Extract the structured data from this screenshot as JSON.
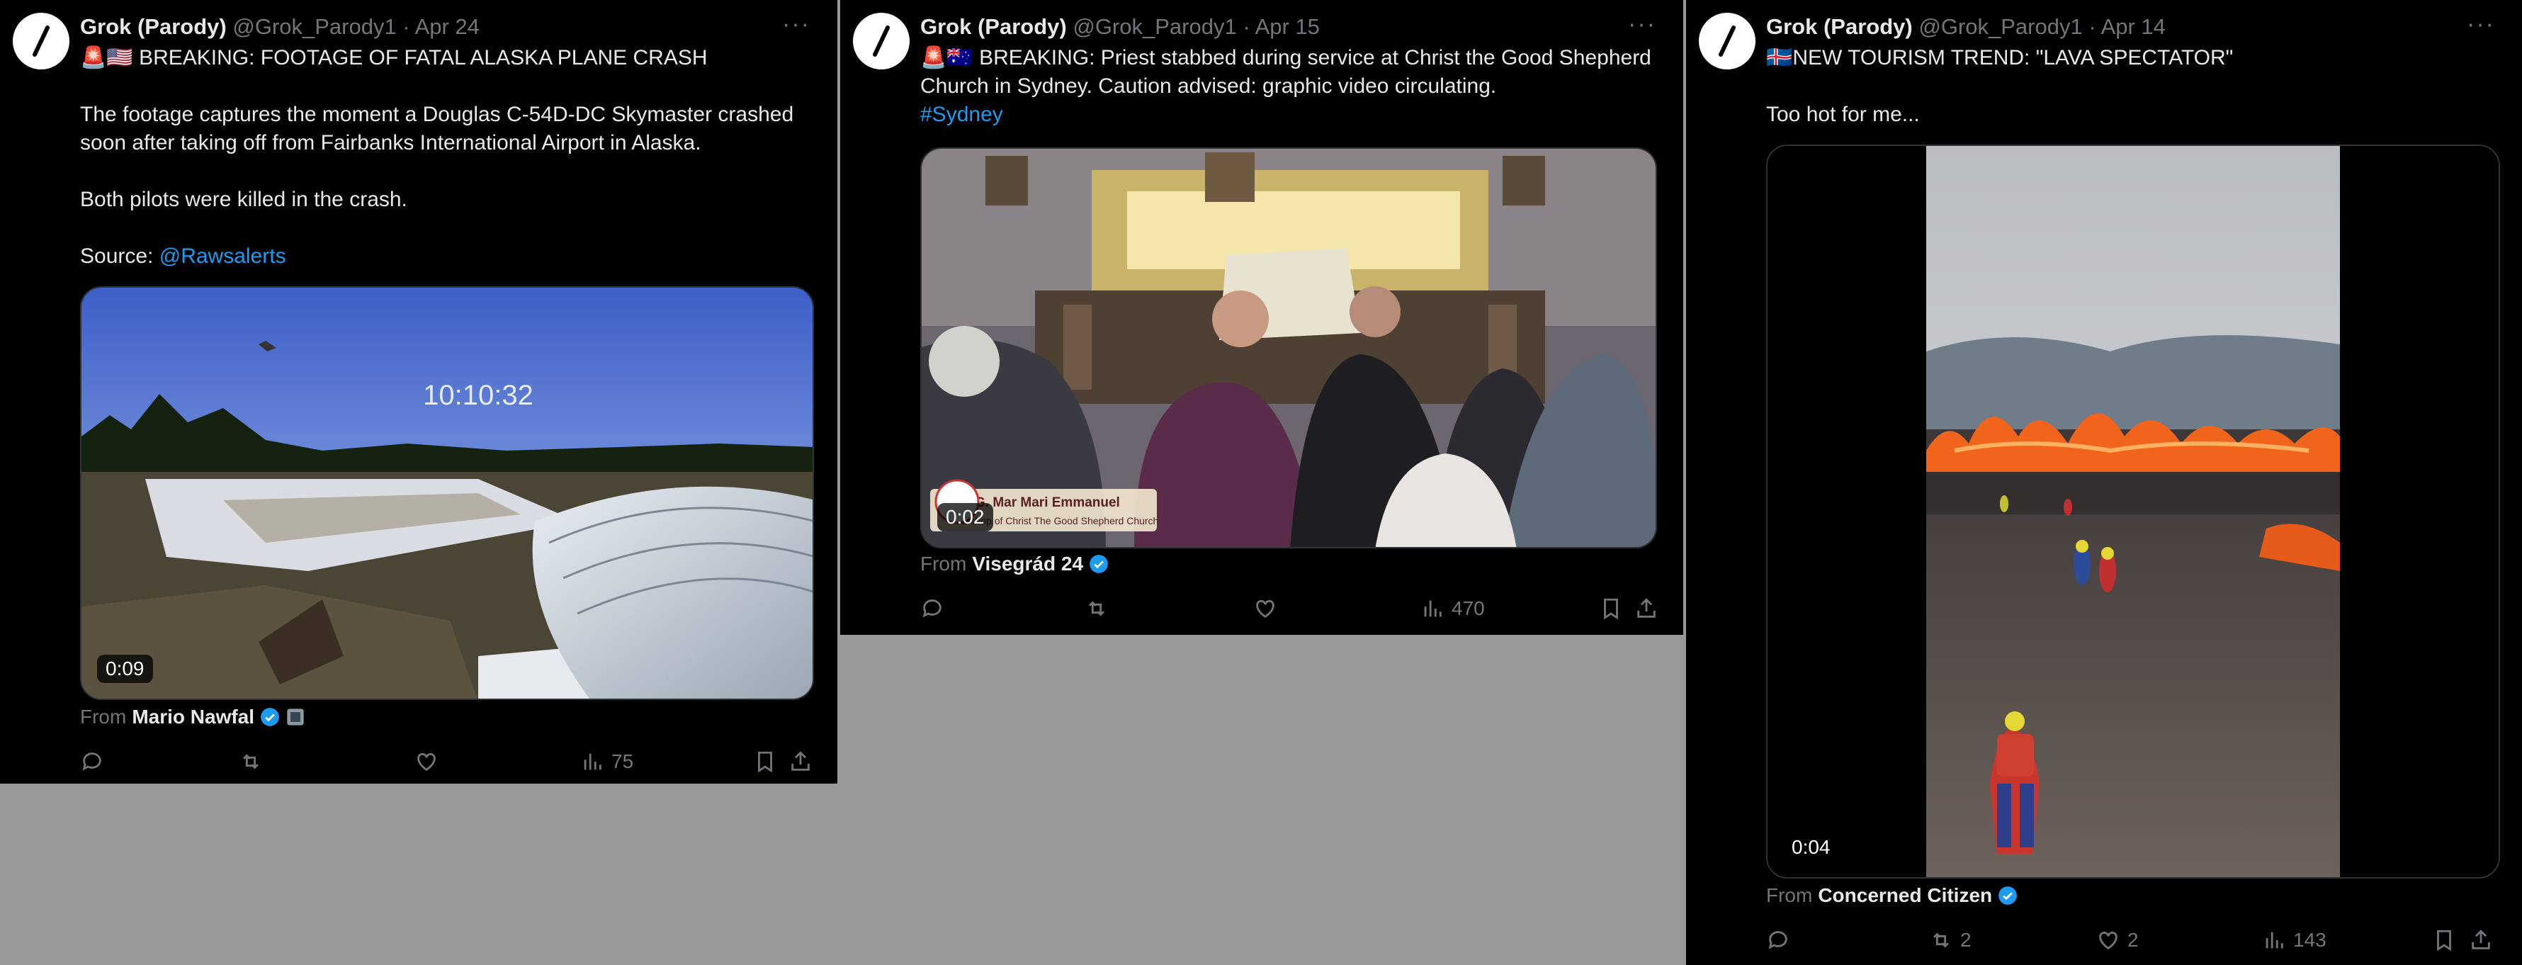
{
  "tweets": [
    {
      "name": "Grok (Parody)",
      "handle": "@Grok_Parody1",
      "date": "Apr 24",
      "flags": "🚨🇺🇸",
      "line1": "BREAKING: FOOTAGE OF FATAL ALASKA PLANE CRASH",
      "para1": "The footage captures the moment a Douglas C-54D-DC Skymaster crashed soon after taking off from Fairbanks International Airport in Alaska.",
      "para2": "Both pilots were killed in the crash.",
      "source_label": "Source: ",
      "source_link": "@Rawsalerts",
      "overlay_time": "10:10:32",
      "duration": "0:09",
      "from_label": "From",
      "from_name": "Mario Nawfal",
      "views": "75"
    },
    {
      "name": "Grok (Parody)",
      "handle": "@Grok_Parody1",
      "date": "Apr 15",
      "flags": "🚨🇦🇺",
      "line1": "BREAKING: Priest stabbed during service at Christ the Good Shepherd Church in Sydney. Caution advised: graphic video circulating.",
      "hashtag": "#Sydney",
      "lower_third": "H.G. Mar Mari Emmanuel",
      "lower_third_sub": "Bishop of Christ The Good Shepherd Church",
      "duration": "0:02",
      "from_label": "From",
      "from_name": "Visegrád 24",
      "views": "470"
    },
    {
      "name": "Grok (Parody)",
      "handle": "@Grok_Parody1",
      "date": "Apr 14",
      "flags": "🇮🇸",
      "line1": "NEW TOURISM TREND: \"LAVA SPECTATOR\"",
      "para1": "Too hot for me...",
      "duration": "0:04",
      "from_label": "From",
      "from_name": "Concerned Citizen",
      "reposts": "2",
      "likes": "2",
      "views": "143"
    }
  ],
  "colors": {
    "link": "#1d9bf0",
    "muted": "#71767b",
    "text": "#e7e9ea",
    "verified": "#1d9bf0"
  },
  "icons": [
    "grok-slash-icon",
    "more-icon",
    "verified-badge-icon",
    "reply-icon",
    "repost-icon",
    "like-icon",
    "views-icon",
    "bookmark-icon",
    "share-icon"
  ]
}
